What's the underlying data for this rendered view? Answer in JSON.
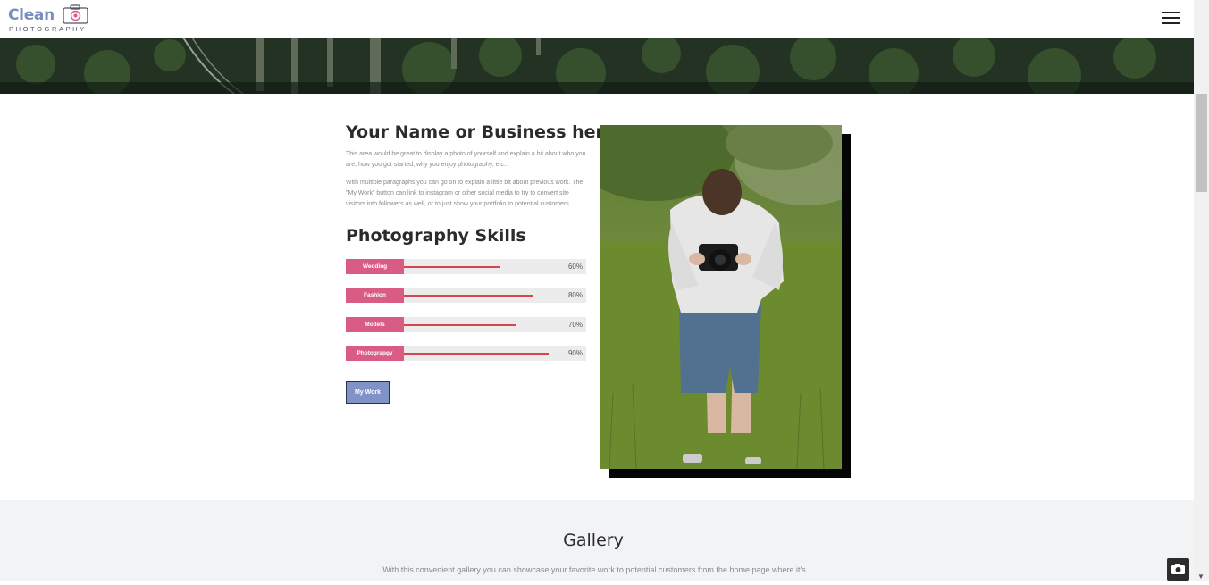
{
  "header": {
    "logo_word": "Clean",
    "logo_sub": "PHOTOGRAPHY",
    "menu_icon": "hamburger-menu-icon"
  },
  "about": {
    "title": "Your Name or Business here",
    "paragraph1": "This area would be great to display a photo of yourself and explain a bit about who you are, how you got started, why you enjoy photography, etc...",
    "paragraph2": "With multiple paragraphs you can go on to explain a little bit about previous work. The \"My Work\" button can link to instagram or other social media to try to convert site visitors into followers as well, or to just show your portfolio to potential customers."
  },
  "skills": {
    "title": "Photography Skills",
    "items": [
      {
        "label": "Wedding",
        "percent": 60,
        "percent_text": "60%"
      },
      {
        "label": "Fashion",
        "percent": 80,
        "percent_text": "80%"
      },
      {
        "label": "Models",
        "percent": 70,
        "percent_text": "70%"
      },
      {
        "label": "Photograpgy",
        "percent": 90,
        "percent_text": "90%"
      }
    ]
  },
  "my_work_button": "My Work",
  "gallery": {
    "title": "Gallery",
    "description": "With this convenient gallery you can showcase your favorite work to potential customers from the home page where it's"
  },
  "colors": {
    "brand_blue": "#7a8fc0",
    "skill_pink": "#d95c85",
    "skill_line_red": "#d8454f",
    "button_blue": "#7f93c9"
  },
  "icons": {
    "fab": "camera-icon"
  }
}
